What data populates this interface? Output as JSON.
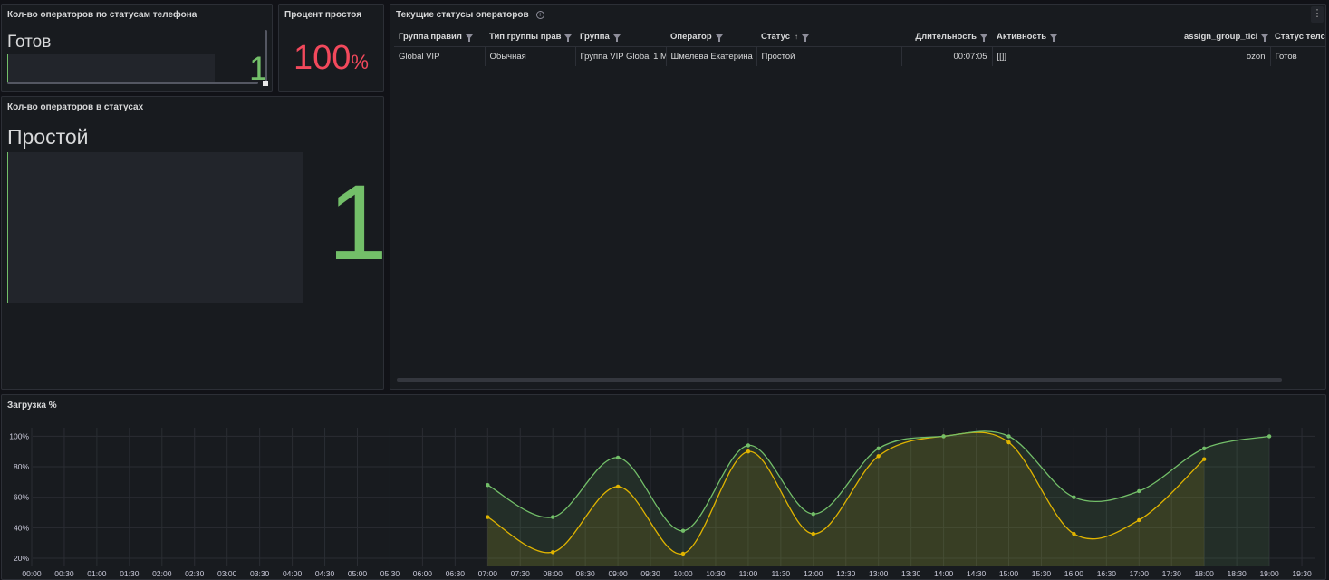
{
  "panel_phone_status": {
    "title": "Кол-во операторов по статусам телефона",
    "state": "Готов",
    "value": "1",
    "accent": "#73bf69"
  },
  "panel_idle_percent": {
    "title": "Процент простоя",
    "value": "100",
    "unit": "%",
    "accent": "#f2495c"
  },
  "panel_operators_status": {
    "title": "Кол-во операторов в статусах",
    "state": "Простой",
    "value": "1",
    "accent": "#73bf69"
  },
  "panel_current_status": {
    "title": "Текущие статусы операторов",
    "info_icon": "info-icon",
    "menu_icon": "kebab-menu-icon",
    "columns": [
      "Группа правил",
      "Тип группы прав",
      "Группа",
      "Оператор",
      "Статус",
      "Длительность",
      "Активность",
      "assign_group_ticl",
      "Статус телс"
    ],
    "rows": [
      [
        "Global VIP",
        "Обычная",
        "Группа VIP Global 1 М",
        "Шмелева Екатерина",
        "Простой",
        "00:07:05",
        "[[]]",
        "ozon",
        "Готов"
      ]
    ]
  },
  "panel_load": {
    "title": "Загрузка %",
    "chart_data": {
      "type": "line",
      "x": [
        "07:00",
        "08:00",
        "09:00",
        "10:00",
        "11:00",
        "12:00",
        "13:00",
        "14:00",
        "15:00",
        "16:00",
        "17:00",
        "18:00",
        "19:00"
      ],
      "x_ticks": [
        "00:00",
        "00:30",
        "01:00",
        "01:30",
        "02:00",
        "02:30",
        "03:00",
        "03:30",
        "04:00",
        "04:30",
        "05:00",
        "05:30",
        "06:00",
        "06:30",
        "07:00",
        "07:30",
        "08:00",
        "08:30",
        "09:00",
        "09:30",
        "10:00",
        "10:30",
        "11:00",
        "11:30",
        "12:00",
        "12:30",
        "13:00",
        "13:30",
        "14:00",
        "14:30",
        "15:00",
        "15:30",
        "16:00",
        "16:30",
        "17:00",
        "17:30",
        "18:00",
        "18:30",
        "19:00",
        "19:30"
      ],
      "y_ticks": [
        "20%",
        "40%",
        "60%",
        "80%",
        "100%"
      ],
      "ylim": [
        14,
        106
      ],
      "grid": true,
      "series": [
        {
          "color": "#73bf69",
          "values": [
            68,
            47,
            86,
            38,
            94,
            49,
            92,
            100,
            100,
            60,
            64,
            92,
            100
          ]
        },
        {
          "color": "#e0b400",
          "values": [
            47,
            24,
            67,
            23,
            90,
            36,
            87,
            100,
            96,
            36,
            45,
            85,
            null
          ]
        }
      ]
    }
  }
}
